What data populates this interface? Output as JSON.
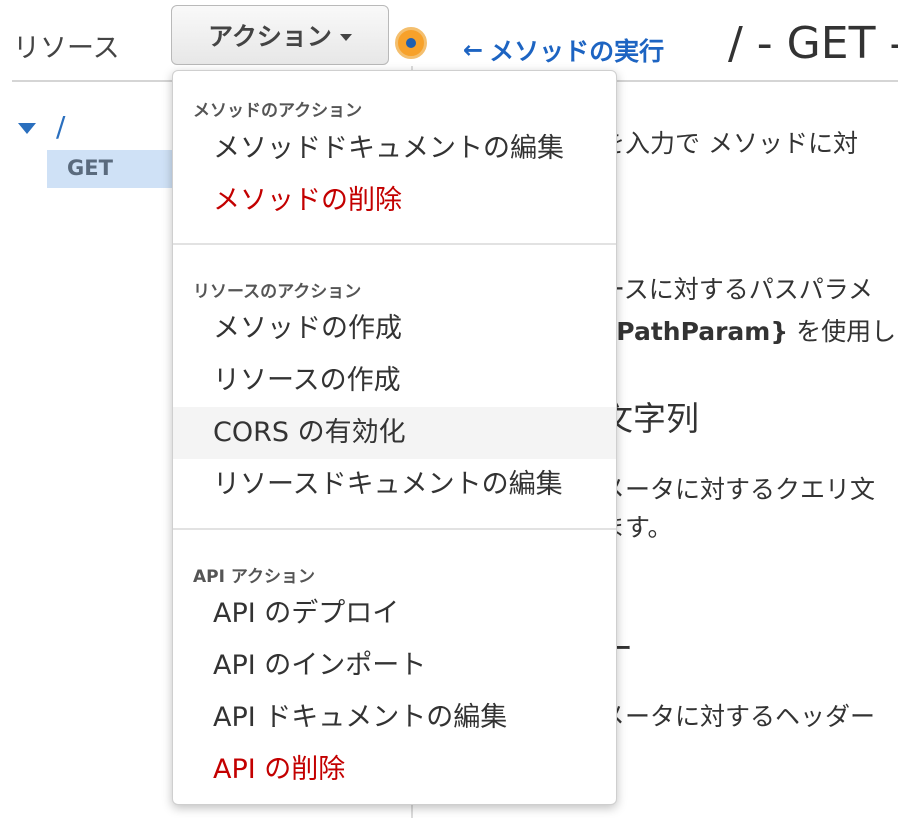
{
  "sidebar": {
    "title": "リソース",
    "tree_root": "/",
    "tree_method": "GET"
  },
  "toolbar": {
    "actions_label": "アクション"
  },
  "header": {
    "back_link": "メソッドの実行",
    "title": "/ - GET -"
  },
  "background_text": {
    "line1": "を入力で メソッドに対",
    "line2": "ースに対するパスパラメ",
    "line3_bold": "yPathParam}",
    "line3_rest": " を使用し",
    "heading1": "文字列",
    "line4": "メータに対するクエリ文",
    "line5": "ます。",
    "heading2": "ー",
    "line6": "メータに対するヘッダー"
  },
  "menu": {
    "sections": [
      {
        "title": "メソッドのアクション",
        "items": [
          {
            "label": "メソッドドキュメントの編集",
            "danger": false
          },
          {
            "label": "メソッドの削除",
            "danger": true
          }
        ]
      },
      {
        "title": "リソースのアクション",
        "items": [
          {
            "label": "メソッドの作成",
            "danger": false
          },
          {
            "label": "リソースの作成",
            "danger": false
          },
          {
            "label": "CORS の有効化",
            "danger": false,
            "hovered": true
          },
          {
            "label": "リソースドキュメントの編集",
            "danger": false
          }
        ]
      },
      {
        "title": "API アクション",
        "items": [
          {
            "label": "API のデプロイ",
            "danger": false
          },
          {
            "label": "API のインポート",
            "danger": false
          },
          {
            "label": "API ドキュメントの編集",
            "danger": false
          },
          {
            "label": "API の削除",
            "danger": true
          }
        ]
      }
    ]
  },
  "colors": {
    "link": "#1d64c2",
    "danger": "#c30000",
    "selected_bg": "#cfe1f6",
    "hover_bg": "#f4f4f4"
  }
}
